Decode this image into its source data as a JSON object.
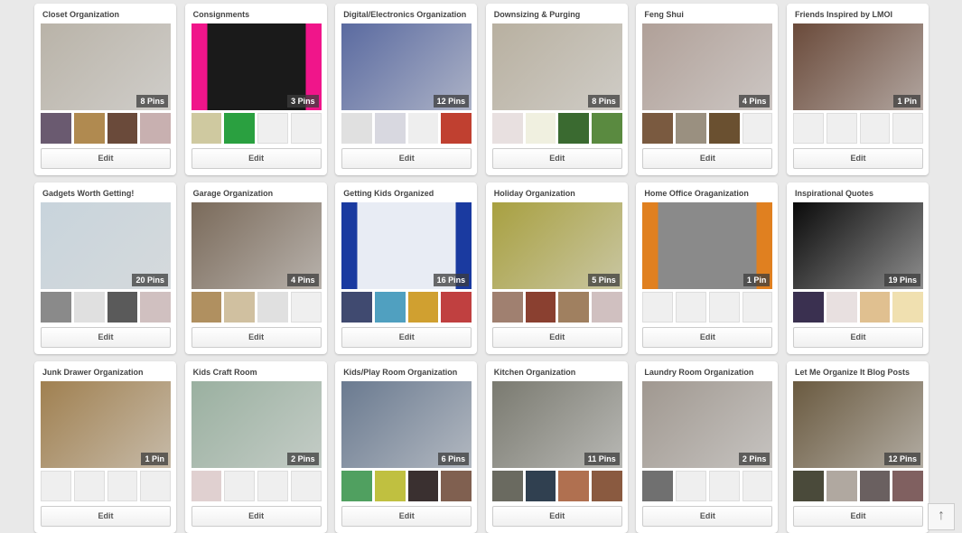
{
  "edit_label": "Edit",
  "boards": [
    {
      "title": "Closet Organization",
      "pins": "8 Pins",
      "color": "#b9b3a8",
      "thumbs": [
        "#6a5a70",
        "#b08a50",
        "#6a4a3a",
        "#c8b0b0"
      ]
    },
    {
      "title": "Consignments",
      "pins": "3 Pins",
      "color": "#1a1a1a",
      "accent": "#f0158a",
      "thumbs": [
        "#cfc9a0",
        "#2aa040",
        null,
        null
      ]
    },
    {
      "title": "Digital/Electronics Organization",
      "pins": "12 Pins",
      "color": "#5a6aa0",
      "thumbs": [
        "#e0e0e0",
        "#d8d8e0",
        "#eeeeee",
        "#c04030"
      ]
    },
    {
      "title": "Downsizing & Purging",
      "pins": "8 Pins",
      "color": "#b8b0a0",
      "thumbs": [
        "#e8e0e0",
        "#f0f0e0",
        "#3a6a30",
        "#5a8a40"
      ]
    },
    {
      "title": "Feng Shui",
      "pins": "4 Pins",
      "color": "#b0a098",
      "thumbs": [
        "#7a5a40",
        "#9a9080",
        "#6a5030",
        null
      ]
    },
    {
      "title": "Friends Inspired by LMOI",
      "pins": "1 Pin",
      "color": "#6a4a3a",
      "thumbs": [
        null,
        null,
        null,
        null
      ]
    },
    {
      "title": "Gadgets Worth Getting!",
      "pins": "20 Pins",
      "color": "#c8d4dc",
      "thumbs": [
        "#8a8a8a",
        "#e0e0e0",
        "#5a5a5a",
        "#d0c0c0"
      ]
    },
    {
      "title": "Garage Organization",
      "pins": "4 Pins",
      "color": "#7a6a5a",
      "thumbs": [
        "#b09060",
        "#d0c0a0",
        "#e0e0e0",
        null
      ]
    },
    {
      "title": "Getting Kids Organized",
      "pins": "16 Pins",
      "color": "#e8ecf4",
      "accent": "#1a3aa0",
      "thumbs": [
        "#404a70",
        "#50a0c0",
        "#d0a030",
        "#c04040"
      ]
    },
    {
      "title": "Holiday Organization",
      "pins": "5 Pins",
      "color": "#a8a040",
      "thumbs": [
        "#a08070",
        "#8a4030",
        "#a08060",
        "#d0c0c0"
      ]
    },
    {
      "title": "Home Office Oraganization",
      "pins": "1 Pin",
      "color": "#8a8a8a",
      "accent": "#e08020",
      "thumbs": [
        null,
        null,
        null,
        null
      ]
    },
    {
      "title": "Inspirational Quotes",
      "pins": "19 Pins",
      "color": "#0a0a0a",
      "thumbs": [
        "#3a3050",
        "#e8e0e0",
        "#e0c090",
        "#f0e0b0"
      ]
    },
    {
      "title": "Junk Drawer Organization",
      "pins": "1 Pin",
      "color": "#a08050",
      "thumbs": [
        null,
        null,
        null,
        null
      ]
    },
    {
      "title": "Kids Craft Room",
      "pins": "2 Pins",
      "color": "#9ab0a0",
      "thumbs": [
        "#e0d0d0",
        null,
        null,
        null
      ]
    },
    {
      "title": "Kids/Play Room Organization",
      "pins": "6 Pins",
      "color": "#6a7a90",
      "thumbs": [
        "#50a060",
        "#c0c040",
        "#3a3030",
        "#806050"
      ]
    },
    {
      "title": "Kitchen Organization",
      "pins": "11 Pins",
      "color": "#7a7a70",
      "thumbs": [
        "#6a6a60",
        "#304050",
        "#b07050",
        "#8a5a40"
      ]
    },
    {
      "title": "Laundry Room Organization",
      "pins": "2 Pins",
      "color": "#a09890",
      "thumbs": [
        "#707070",
        null,
        null,
        null
      ]
    },
    {
      "title": "Let Me Organize It Blog Posts",
      "pins": "12 Pins",
      "color": "#6a5a40",
      "thumbs": [
        "#4a4a3a",
        "#b0a8a0",
        "#6a6060",
        "#806060"
      ]
    }
  ],
  "back_to_top": "↑"
}
